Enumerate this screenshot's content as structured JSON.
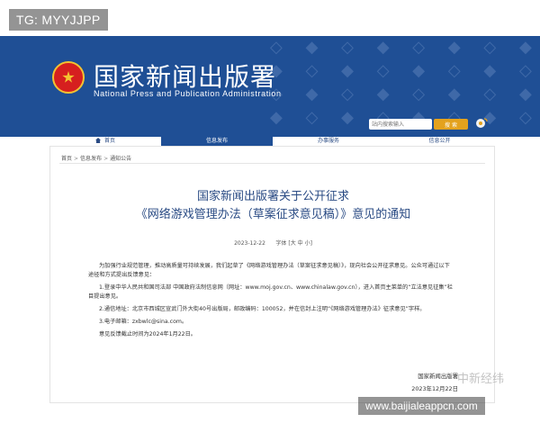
{
  "overlays": {
    "tg_tag": "TG: MYYJJPP",
    "watermark_cn": "中新经纬",
    "url_tag": "www.baijialeappcn.com"
  },
  "header": {
    "agency_cn": "国家新闻出版署",
    "agency_en": "National Press and Publication Administration",
    "search_placeholder": "站内搜索输入",
    "search_button": "搜 索"
  },
  "nav": {
    "items": [
      {
        "label": "首页"
      },
      {
        "label": "信息发布"
      },
      {
        "label": "办事服务"
      },
      {
        "label": "信息公开"
      }
    ],
    "active_index": 1
  },
  "breadcrumb": [
    "首页",
    "信息发布",
    "通知公告"
  ],
  "article": {
    "title_line1": "国家新闻出版署关于公开征求",
    "title_line2": "《网络游戏管理办法（草案征求意见稿）》意见的通知",
    "date": "2023-12-22",
    "font_label": "字体",
    "size_options": [
      "大",
      "中",
      "小"
    ],
    "paragraphs": [
      "为加强行业规范管理，推动高质量可持续发展，我们起草了《网络游戏管理办法（草案征求意见稿）》，现向社会公开征求意见。公众可通过以下途径和方式提出反馈意见：",
      "1.登录中华人民共和国司法部 中国政府法制信息网（网址：www.moj.gov.cn、www.chinalaw.gov.cn），进入首页主菜单的“立法意见征集”栏目提出意见。",
      "2.通信地址：北京市西城区宣武门外大街40号出版局，邮政编码：100052，并在信封上注明“《网络游戏管理办法》征求意见”字样。",
      "3.电子邮箱：zxbwlc@sina.com。",
      "意见反馈截止时间为2024年1月22日。"
    ],
    "signature": "国家新闻出版署",
    "signature_date": "2023年12月22日"
  }
}
